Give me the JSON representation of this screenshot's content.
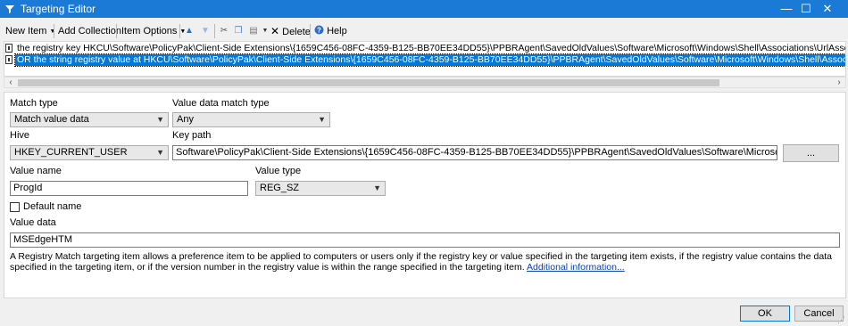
{
  "window": {
    "title": "Targeting Editor",
    "minimize": "—",
    "maximize": "☐",
    "close": "✕"
  },
  "toolbar": {
    "new_item": "New Item",
    "add_collection": "Add Collection",
    "item_options": "Item Options",
    "delete": "Delete",
    "help": "Help"
  },
  "tree": {
    "items": [
      "the registry key HKCU\\Software\\PolicyPak\\Client-Side Extensions\\{1659C456-08FC-4359-B125-BB70EE34DD55}\\PPBRAgent\\SavedOldValues\\Software\\Microsoft\\Windows\\Shell\\Associations\\UrlAssociations\\http\\UserChoice does not exist",
      "OR the string registry value at HKCU\\Software\\PolicyPak\\Client-Side Extensions\\{1659C456-08FC-4359-B125-BB70EE34DD55}\\PPBRAgent\\SavedOldValues\\Software\\Microsoft\\Windows\\Shell\\Associations\\UrlAssociations\\http\\UserChoice"
    ],
    "selected_index": 1
  },
  "form": {
    "match_type_label": "Match type",
    "match_type_value": "Match value data",
    "value_data_match_type_label": "Value data match type",
    "value_data_match_type_value": "Any",
    "hive_label": "Hive",
    "hive_value": "HKEY_CURRENT_USER",
    "key_path_label": "Key path",
    "key_path_value": "Software\\PolicyPak\\Client-Side Extensions\\{1659C456-08FC-4359-B125-BB70EE34DD55}\\PPBRAgent\\SavedOldValues\\Software\\Microsoft\\Windows\\Shell\\Associations\\UrlA",
    "browse_label": "...",
    "value_name_label": "Value name",
    "value_name_value": "ProgId",
    "value_type_label": "Value type",
    "value_type_value": "REG_SZ",
    "default_name_label": "Default name",
    "value_data_label": "Value data",
    "value_data_value": "MSEdgeHTM",
    "description": "A Registry Match targeting item allows a preference item to be applied to computers or users only if the registry key or value specified in the targeting item exists, if the registry value contains the data specified in the targeting item, or if the version number in the registry value is within the range specified in the targeting item.",
    "more_info_link": "Additional information..."
  },
  "footer": {
    "ok": "OK",
    "cancel": "Cancel"
  },
  "colors": {
    "titlebar": "#1a7ad6",
    "selection": "#0078d7",
    "link": "#0645ad"
  }
}
